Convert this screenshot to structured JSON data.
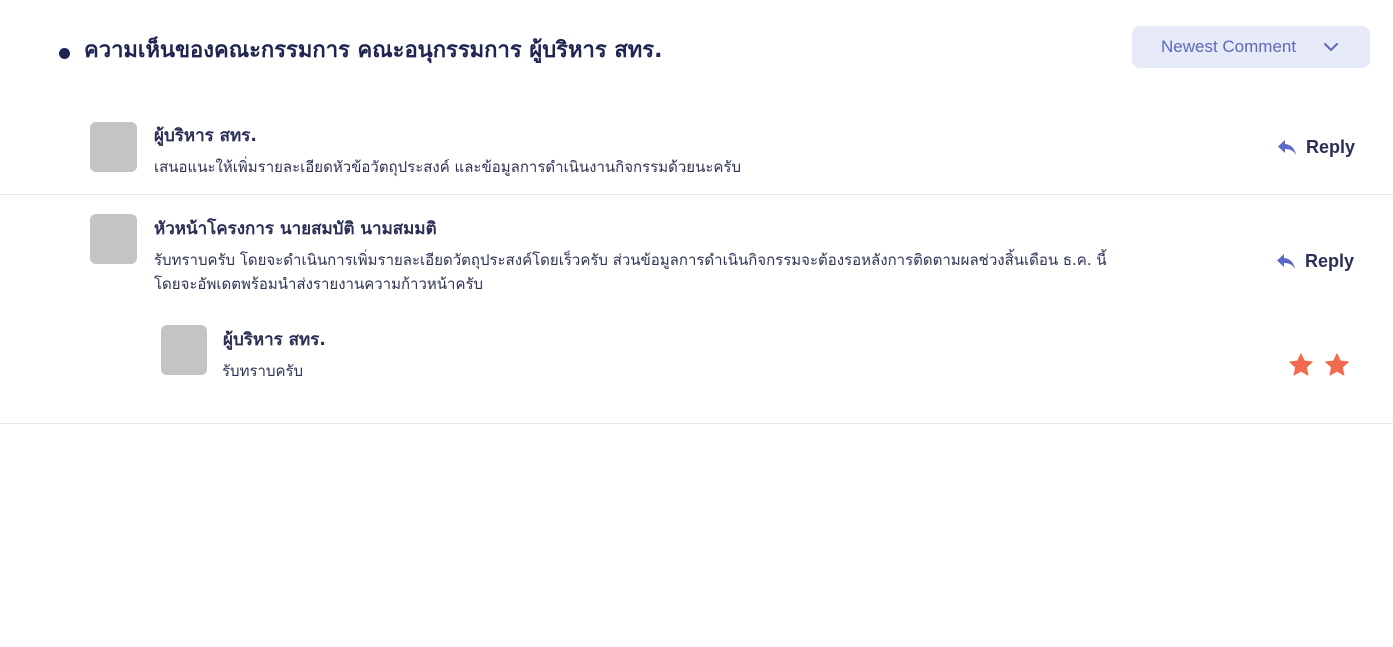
{
  "header": {
    "title": "ความเห็นของคณะกรรมการ คณะอนุกรรมการ ผู้บริหาร สทร.",
    "sort": {
      "selected": "Newest Comment",
      "icon": "chevron-down-icon"
    }
  },
  "comments": [
    {
      "author": "ผู้บริหาร สทร.",
      "text": "เสนอแนะให้เพิ่มรายละเอียดหัวข้อวัตถุประสงค์ และข้อมูลการดำเนินงานกิจกรรมด้วยนะครับ",
      "action": "Reply",
      "action_icon": "reply-icon"
    },
    {
      "author": "หัวหน้าโครงการ นายสมบัติ นามสมมติ",
      "text_lines": [
        "รับทราบครับ โดยจะดำเนินการเพิ่มรายละเอียดวัตถุประสงค์โดยเร็วครับ ส่วนข้อมูลการดำเนินกิจกรรมจะต้องรอหลังการติดตามผลช่วงสิ้นเดือน ธ.ค. นี้",
        "โดยจะอัพเดตพร้อมนำส่งรายงานความก้าวหน้าครับ"
      ],
      "action": "Reply",
      "action_icon": "reply-icon",
      "replies": [
        {
          "author": "ผู้บริหาร สทร.",
          "text": "รับทราบครับ",
          "rating": 2,
          "rating_icon": "star-icon",
          "rating_color": "#f26b4f"
        }
      ]
    }
  ],
  "colors": {
    "primary_text": "#1f2552",
    "accent": "#5e69b7",
    "dropdown_bg": "#e6e9f7",
    "avatar_placeholder": "#c4c4c4",
    "reply_icon": "#5b6ac8",
    "star": "#f26b4f"
  }
}
